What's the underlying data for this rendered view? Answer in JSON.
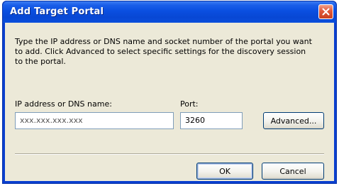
{
  "dialog": {
    "title": "Add Target Portal",
    "instructions": "Type the IP address or DNS name and socket number of the portal you want to add. Click Advanced to select specific settings for the discovery session to the portal.",
    "ip_label": "IP address or DNS name:",
    "ip_value": "xxx.xxx.xxx.xxx",
    "port_label": "Port:",
    "port_value": "3260",
    "advanced_label": "Advanced...",
    "ok_label": "OK",
    "cancel_label": "Cancel"
  },
  "colors": {
    "titlebar": "#0a4fe0",
    "dialog_background": "#ece9d8",
    "close_button": "#e0583a"
  },
  "icons": {
    "close": "close-icon"
  }
}
